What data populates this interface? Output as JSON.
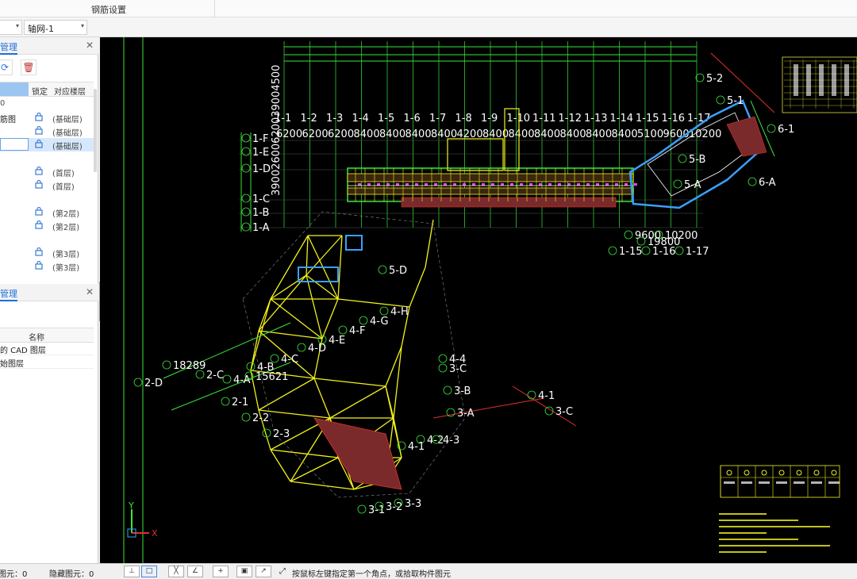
{
  "topbar": {
    "title": "钢筋设置"
  },
  "toolbar": {
    "combo_left_arrow": "▾",
    "axis_combo": "轴网-1"
  },
  "layer_panel": {
    "title": "管理",
    "columns": {
      "lock": "锁定",
      "floor": "对应楼层"
    },
    "rows": [
      {
        "name": "筋图",
        "floor": "(基础层)"
      },
      {
        "name": "",
        "floor": "(基础层)"
      },
      {
        "name": "",
        "floor": "(基础层)",
        "selected": true
      },
      {
        "name": "",
        "floor": "(首层)"
      },
      {
        "name": "",
        "floor": "(首层)"
      },
      {
        "name": "",
        "floor": "(第2层)"
      },
      {
        "name": "",
        "floor": "(第2层)"
      },
      {
        "name": "",
        "floor": "(第3层)"
      },
      {
        "name": "",
        "floor": "(第3层)"
      }
    ]
  },
  "cad_panel": {
    "title": "管理",
    "column_name": "名称",
    "rows": [
      "的 CAD 图层",
      "始图层"
    ]
  },
  "status": {
    "selected": "图元：0",
    "hidden": "隐藏图元：0",
    "hint": "按鼠标左键指定第一个角点，或拾取构件图元"
  },
  "cad": {
    "top_axes": [
      "1-1",
      "1-2",
      "1-3",
      "1-4",
      "1-5",
      "1-6",
      "1-7",
      "1-8",
      "1-9",
      "1-10",
      "1-11",
      "1-12",
      "1-13",
      "1-14",
      "1-15",
      "1-16",
      "1-17"
    ],
    "top_dims": [
      "6200",
      "6200",
      "6200",
      "8400",
      "8400",
      "8400",
      "8400",
      "4200",
      "8400",
      "8400",
      "8400",
      "8400",
      "8400",
      "8400",
      "5100",
      "9600",
      "10200"
    ],
    "left_axes": [
      "1-F",
      "1-E",
      "1-D",
      "1-C",
      "1-B",
      "1-A"
    ],
    "left_dims": [
      "3900",
      "2600",
      "6200",
      "3900",
      "4500"
    ],
    "bottom_axes": [
      "1-15",
      "1-16",
      "1-17"
    ],
    "bottom_dims": [
      "9600",
      "10200",
      "19800"
    ],
    "misc_labels": [
      "5-1",
      "5-2",
      "5-B",
      "5-A",
      "5-D",
      "6-1",
      "6-A",
      "2-D",
      "2-C",
      "2-1",
      "2-2",
      "2-3",
      "3-C",
      "3-B",
      "3-A",
      "3-1",
      "3-2",
      "3-3",
      "4-A",
      "4-B",
      "4-C",
      "4-D",
      "4-E",
      "4-F",
      "4-G",
      "4-H",
      "4-1",
      "4-2",
      "4-3",
      "4-4",
      "18289",
      "15621"
    ],
    "colors": {
      "background": "#000000",
      "axis_green": "#39e639",
      "beam_yellow": "#f2f21a",
      "text_white": "#ffffff",
      "outline_cyan": "#3aa0ff",
      "boundary_red": "#e03030"
    }
  }
}
